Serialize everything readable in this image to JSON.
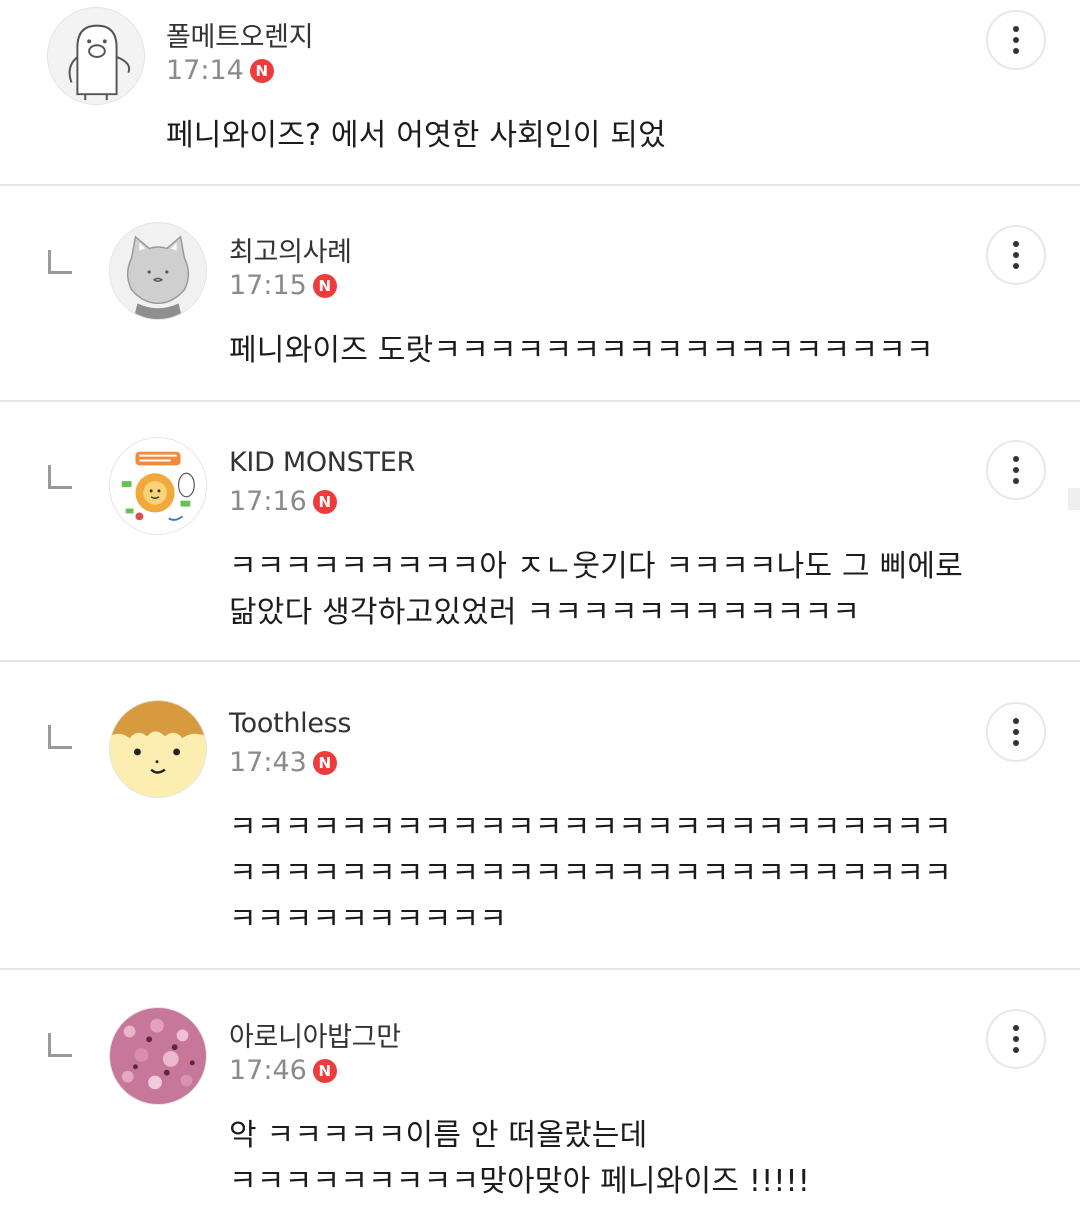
{
  "badge_label": "N",
  "comments": [
    {
      "nickname": "폴메트오렌지",
      "time": "17:14",
      "avatar_icon": "penguin-pig-icon",
      "lines": [
        "페니와이즈? 에서 어엿한 사회인이 되었"
      ]
    },
    {
      "nickname": "최고의사례",
      "time": "17:15",
      "avatar_icon": "gray-cat-icon",
      "lines": [
        "페니와이즈 도랏ㅋㅋㅋㅋㅋㅋㅋㅋㅋㅋㅋㅋㅋㅋㅋㅋㅋㅋ"
      ]
    },
    {
      "nickname": "KID MONSTER",
      "time": "17:16",
      "avatar_icon": "lion-drawing-icon",
      "lines": [
        "ㅋㅋㅋㅋㅋㅋㅋㅋㅋ아 ㅈㄴ웃기다 ㅋㅋㅋㅋ나도 그 삐에로",
        "닮았다 생각하고있었러 ㅋㅋㅋㅋㅋㅋㅋㅋㅋㅋㅋㅋ"
      ]
    },
    {
      "nickname": "Toothless",
      "time": "17:43",
      "avatar_icon": "smiley-face-icon",
      "lines": [
        "ㅋㅋㅋㅋㅋㅋㅋㅋㅋㅋㅋㅋㅋㅋㅋㅋㅋㅋㅋㅋㅋㅋㅋㅋㅋㅋ",
        "ㅋㅋㅋㅋㅋㅋㅋㅋㅋㅋㅋㅋㅋㅋㅋㅋㅋㅋㅋㅋㅋㅋㅋㅋㅋㅋ",
        "ㅋㅋㅋㅋㅋㅋㅋㅋㅋㅋ"
      ]
    },
    {
      "nickname": "아로니아밥그만",
      "time": "17:46",
      "avatar_icon": "pink-rice-icon",
      "lines": [
        "악 ㅋㅋㅋㅋㅋ이름 안 떠올랐는데",
        "ㅋㅋㅋㅋㅋㅋㅋㅋㅋ맞아맞아 페니와이즈 !!!!!"
      ]
    }
  ],
  "colors": {
    "badge": "#ef3b3b",
    "divider": "#e6e6e6",
    "time_text": "#8a8a8a"
  }
}
